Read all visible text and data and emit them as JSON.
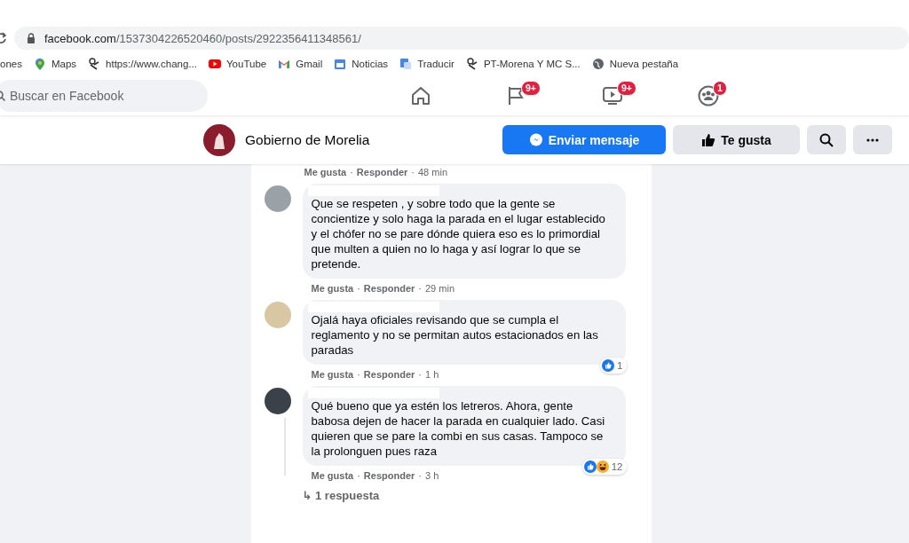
{
  "browser": {
    "address": "facebook.com/1537304226520460/posts/2922356411348561/",
    "bookmarks": [
      {
        "label": "ones",
        "kind": "none"
      },
      {
        "label": "Maps",
        "kind": "maps"
      },
      {
        "label": "https://www.chang...",
        "kind": "change"
      },
      {
        "label": "YouTube",
        "kind": "youtube"
      },
      {
        "label": "Gmail",
        "kind": "gmail"
      },
      {
        "label": "Noticias",
        "kind": "news"
      },
      {
        "label": "Traducir",
        "kind": "translate"
      },
      {
        "label": "PT-Morena Y MC S...",
        "kind": "change"
      },
      {
        "label": "Nueva pestaña",
        "kind": "globe"
      }
    ]
  },
  "header": {
    "search": {
      "placeholder": "Buscar en Facebook"
    },
    "nav": [
      {
        "kind": "home"
      },
      {
        "kind": "flag",
        "badge": "9+"
      },
      {
        "kind": "video",
        "badge": "9+"
      },
      {
        "kind": "groups",
        "badge": "1"
      }
    ]
  },
  "page_bar": {
    "name": "Gobierno de Morelia",
    "buttons": [
      {
        "kind": "message",
        "label": "Enviar mensaje"
      },
      {
        "kind": "like",
        "label": "Te gusta"
      },
      {
        "kind": "search"
      },
      {
        "kind": "more"
      }
    ]
  },
  "top_meta": [
    {
      "kind": "link",
      "text": "Me gusta"
    },
    {
      "kind": "sep",
      "text": "·"
    },
    {
      "kind": "link",
      "text": "Responder"
    },
    {
      "kind": "sep",
      "text": "·"
    },
    {
      "kind": "time",
      "text": "48 min"
    }
  ],
  "comments": [
    {
      "text": "Que se respeten , y sobre todo que la gente se concientize y solo haga la parada en el lugar establecido y el chófer no se pare dónde quiera eso es lo primordial que multen a quien no lo haga y así lograr lo que se pretende.",
      "meta": [
        {
          "kind": "link",
          "text": "Me gusta"
        },
        {
          "kind": "sep",
          "text": "·"
        },
        {
          "kind": "link",
          "text": "Responder"
        },
        {
          "kind": "sep",
          "text": "·"
        },
        {
          "kind": "time",
          "text": "29 min"
        }
      ]
    },
    {
      "text": "Ojalá haya oficiales revisando que se cumpla el reglamento y no se permitan autos estacionados en las paradas",
      "meta": [
        {
          "kind": "link",
          "text": "Me gusta"
        },
        {
          "kind": "sep",
          "text": "·"
        },
        {
          "kind": "link",
          "text": "Responder"
        },
        {
          "kind": "sep",
          "text": "·"
        },
        {
          "kind": "time",
          "text": "1 h"
        }
      ],
      "reactions": {
        "types": [
          {
            "kind": "like"
          }
        ],
        "count": "1"
      }
    },
    {
      "text": "Qué bueno que ya estén los letreros. Ahora, gente babosa dejen de hacer la parada en cualquier lado. Casi quieren que se pare la combi en sus casas. Tampoco se la prolonguen pues raza",
      "meta": [
        {
          "kind": "link",
          "text": "Me gusta"
        },
        {
          "kind": "sep",
          "text": "·"
        },
        {
          "kind": "link",
          "text": "Responder"
        },
        {
          "kind": "sep",
          "text": "·"
        },
        {
          "kind": "time",
          "text": "3 h"
        }
      ],
      "reactions": {
        "types": [
          {
            "kind": "like"
          },
          {
            "kind": "haha"
          }
        ],
        "count": "12"
      },
      "replies": {
        "arrow": "↳",
        "label": "1 respuesta"
      }
    }
  ]
}
